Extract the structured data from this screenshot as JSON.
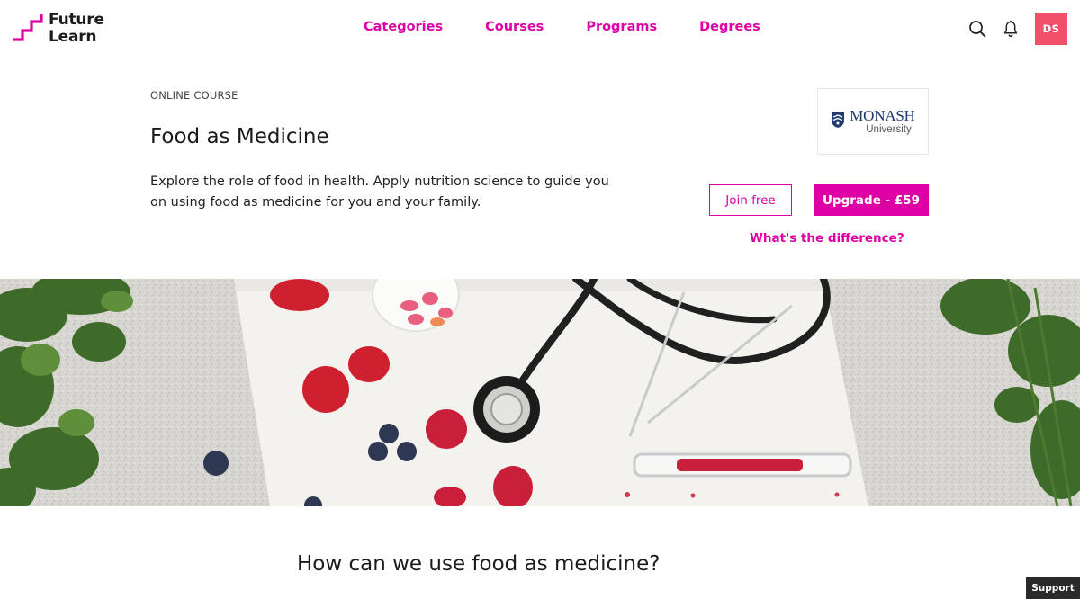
{
  "brand": {
    "line1": "Future",
    "line2": "Learn",
    "accent": "#de00a5"
  },
  "nav": {
    "items": [
      "Categories",
      "Courses",
      "Programs",
      "Degrees"
    ]
  },
  "header": {
    "avatar_initials": "DS",
    "avatar_color": "#f24f6a"
  },
  "course": {
    "eyebrow": "ONLINE COURSE",
    "title": "Food as Medicine",
    "description": "Explore the role of food in health. Apply nutrition science to guide you on using food as medicine for you and your family.",
    "partner": {
      "name": "MONASH",
      "sub": "University"
    },
    "join_label": "Join free",
    "upgrade_label": "Upgrade - £59",
    "difference_link": "What's the difference?"
  },
  "section": {
    "heading": "How can we use food as medicine?"
  },
  "support_label": "Support"
}
